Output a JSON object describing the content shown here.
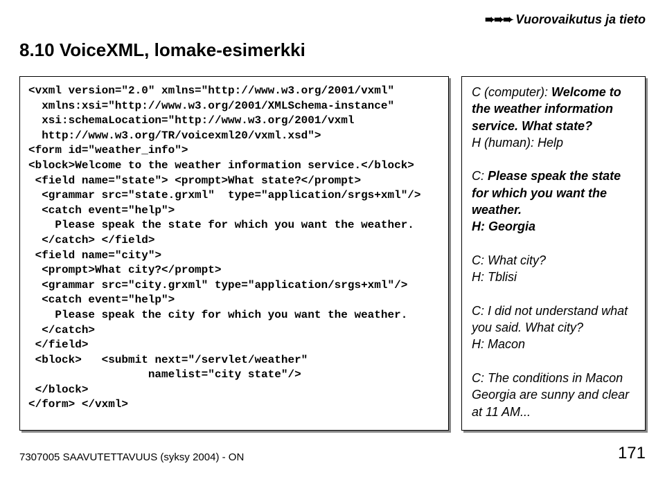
{
  "breadcrumb": "Vuorovaikutus ja tieto",
  "heading": "8.10 VoiceXML, lomake-esimerkki",
  "code": "<vxml version=\"2.0\" xmlns=\"http://www.w3.org/2001/vxml\"\n  xmlns:xsi=\"http://www.w3.org/2001/XMLSchema-instance\"\n  xsi:schemaLocation=\"http://www.w3.org/2001/vxml\n  http://www.w3.org/TR/voicexml20/vxml.xsd\">\n<form id=\"weather_info\">\n<block>Welcome to the weather information service.</block>\n <field name=\"state\"> <prompt>What state?</prompt>\n  <grammar src=\"state.grxml\"  type=\"application/srgs+xml\"/>\n  <catch event=\"help\">\n    Please speak the state for which you want the weather.\n  </catch> </field>\n <field name=\"city\">\n  <prompt>What city?</prompt>\n  <grammar src=\"city.grxml\" type=\"application/srgs+xml\"/>\n  <catch event=\"help\">\n    Please speak the city for which you want the weather.\n  </catch>\n </field>\n <block>   <submit next=\"/servlet/weather\"\n                  namelist=\"city state\"/>\n </block>\n</form> </vxml>",
  "dialog": {
    "l1a": "C (computer): ",
    "l1b": "Welcome to the weather information service. What state?",
    "l2": "H (human): Help",
    "l3a": "C: ",
    "l3b": "Please speak the state for which you want the weather.",
    "l4": "H: Georgia",
    "l5": "C: What city?",
    "l6": "H: Tblisi",
    "l7": "C: I did not understand what you said. What city?",
    "l8": "H: Macon",
    "l9": "C: The conditions in Macon Georgia are sunny and clear at 11 AM..."
  },
  "footer_left": "7307005 SAAVUTETTAVUUS (syksy 2004) - ON",
  "footer_right": "171"
}
